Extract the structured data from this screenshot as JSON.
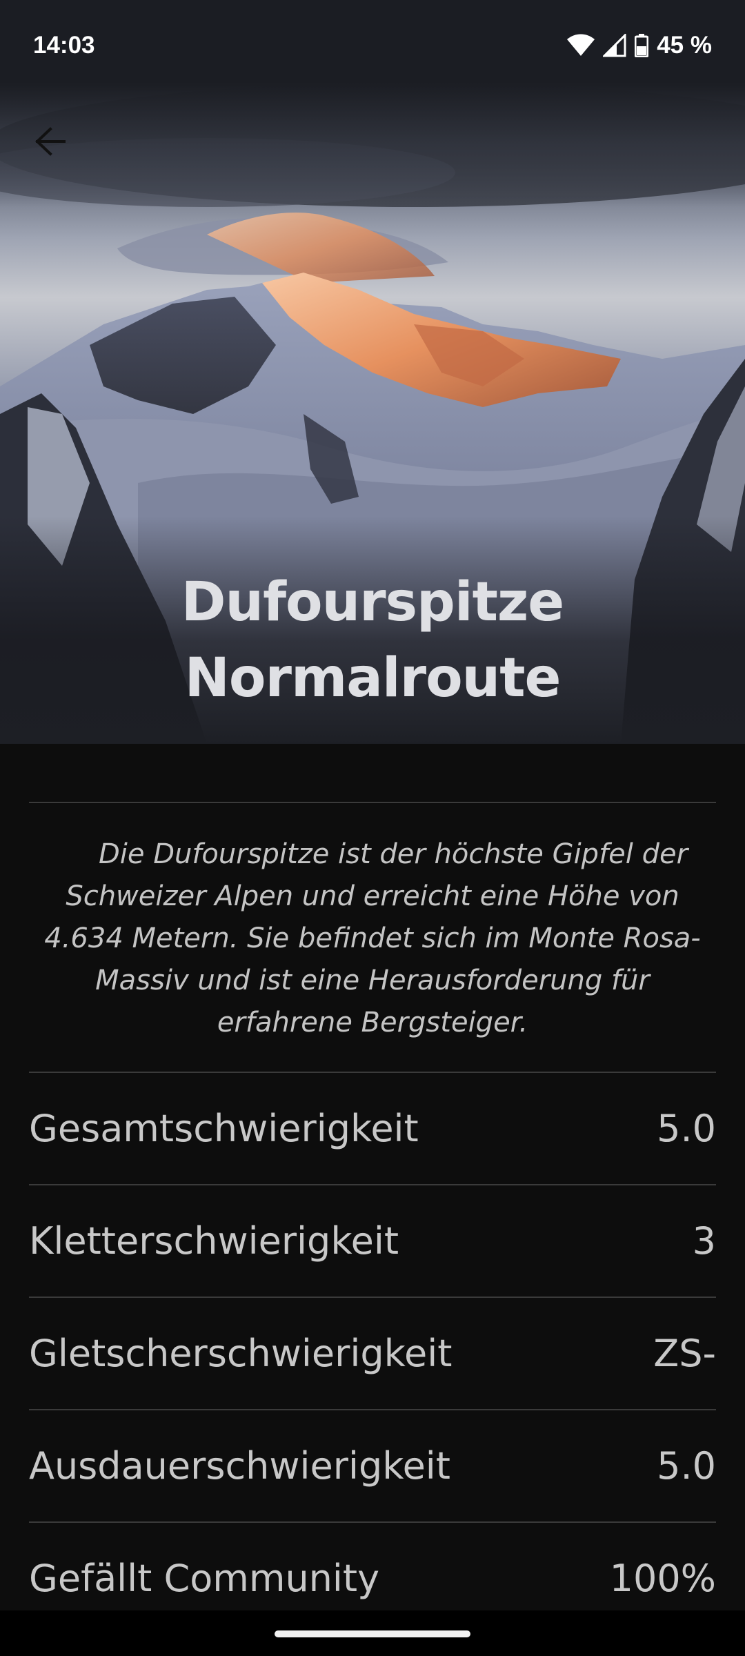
{
  "status_bar": {
    "time": "14:03",
    "battery": "45 %",
    "icons": [
      "wifi-icon",
      "signal-icon",
      "battery-icon"
    ]
  },
  "header": {
    "back_icon": "arrow-left-icon",
    "title_line1": "Dufourspitze",
    "title_line2": "Normalroute"
  },
  "description": "Die Dufourspitze ist der höchste Gipfel der Schweizer Alpen und erreicht eine Höhe von 4.634 Metern. Sie befindet sich im Monte Rosa-Massiv und ist eine Herausforderung für erfahrene Bergsteiger.",
  "stats": [
    {
      "label": "Gesamtschwierigkeit",
      "value": "5.0"
    },
    {
      "label": "Kletterschwierigkeit",
      "value": "3"
    },
    {
      "label": "Gletscherschwierigkeit",
      "value": "ZS-"
    },
    {
      "label": "Ausdauerschwierigkeit",
      "value": "5.0"
    },
    {
      "label": "Gefällt Community",
      "value": "100%"
    }
  ],
  "colors": {
    "background": "#0d0d0d",
    "divider": "#3a3a3a",
    "text": "#c8c8c8",
    "alpenglow": "#f0a070"
  }
}
